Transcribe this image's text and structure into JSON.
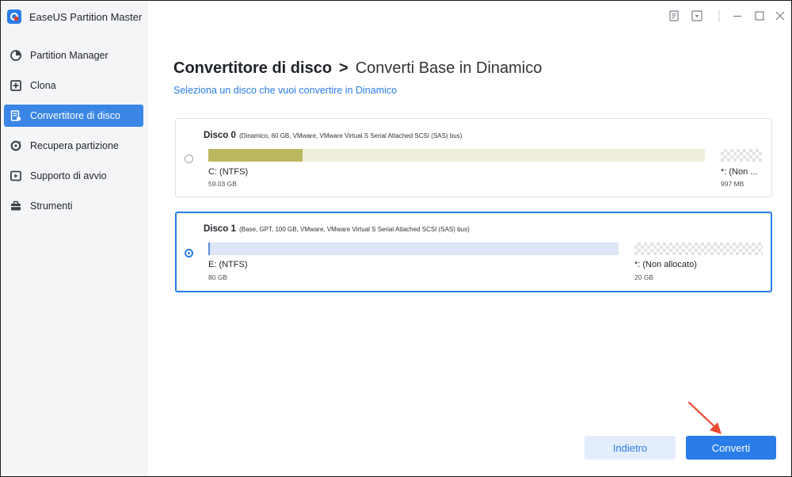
{
  "app": {
    "title": "EaseUS Partition Master"
  },
  "sidebar": {
    "items": [
      {
        "label": "Partition Manager",
        "icon": "pie-chart-icon",
        "active": false
      },
      {
        "label": "Clona",
        "icon": "clone-icon",
        "active": false
      },
      {
        "label": "Convertitore di disco",
        "icon": "disk-convert-icon",
        "active": true
      },
      {
        "label": "Recupera partizione",
        "icon": "recovery-icon",
        "active": false
      },
      {
        "label": "Supporto di avvio",
        "icon": "bootable-media-icon",
        "active": false
      },
      {
        "label": "Strumenti",
        "icon": "toolbox-icon",
        "active": false
      }
    ]
  },
  "header": {
    "title_main": "Convertitore di disco",
    "title_sep": ">",
    "title_sub": "Converti Base in Dinamico",
    "subtitle": "Seleziona un disco che vuoi convertire in Dinamico"
  },
  "disks": [
    {
      "name": "Disco 0",
      "info": "(Dinamico, 60 GB, VMware,  VMware Virtual S Serial Attached SCSI (SAS) bus)",
      "selected": false,
      "partitions": [
        {
          "label": "C: (NTFS)",
          "size": "59.03 GB",
          "used_fraction": 0.19,
          "color": "#bcb860",
          "track_color": "#efeedb"
        },
        {
          "label": "*: (Non ...",
          "size": "997 MB",
          "unallocated": true
        }
      ]
    },
    {
      "name": "Disco 1",
      "info": "(Base, GPT, 100 GB, VMware,  VMware Virtual S Serial Attached SCSI (SAS) bus)",
      "selected": true,
      "partitions": [
        {
          "label": "E: (NTFS)",
          "size": "80 GB",
          "used_fraction": 0.003,
          "color": "#8fb1e8",
          "track_color": "#dfe6f5"
        },
        {
          "label": "*: (Non allocato)",
          "size": "20 GB",
          "unallocated": true
        }
      ]
    }
  ],
  "buttons": {
    "back": "Indietro",
    "convert": "Converti"
  },
  "colors": {
    "accent": "#2a7de8",
    "sidebar_bg": "#f4f5f7",
    "arrow": "#ee4a32"
  }
}
